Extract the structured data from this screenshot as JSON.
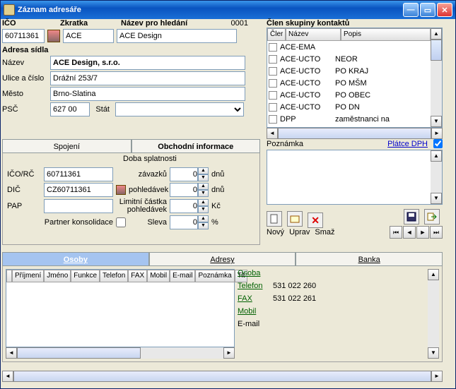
{
  "window": {
    "title": "Záznam adresáře"
  },
  "top": {
    "ico_label": "IČO",
    "zkratka_label": "Zkratka",
    "nazev_label": "Název pro hledání",
    "number": "0001",
    "ico": "60711361",
    "zkratka": "ACE",
    "nazev": "ACE Design"
  },
  "address": {
    "header": "Adresa sídla",
    "nazev_lbl": "Název",
    "nazev": "ACE Design, s.r.o.",
    "ulice_lbl": "Ulice a číslo",
    "ulice": "Drážní 253/7",
    "mesto_lbl": "Město",
    "mesto": "Brno-Slatina",
    "psc_lbl": "PSČ",
    "psc": "627 00",
    "stat_lbl": "Stát"
  },
  "tabs1": {
    "spojeni": "Spojení",
    "obchodni": "Obchodní informace"
  },
  "obchodni": {
    "doba": "Doba splatnosti",
    "icorc_lbl": "IČO/RČ",
    "icorc": "60711361",
    "dic_lbl": "DIČ",
    "dic": "CZ60711361",
    "pap_lbl": "PAP",
    "pap": "",
    "partner_lbl": "Partner konsolidace",
    "zavazku": "závazků",
    "zavazku_v": "0",
    "dnu": "dnů",
    "pohledavek": "pohledávek",
    "pohledavek_v": "0",
    "limit": "Limitní částka pohledávek",
    "limit_v": "0",
    "kc": "Kč",
    "sleva": "Sleva",
    "sleva_v": "0",
    "pct": "%"
  },
  "member": {
    "header": "Člen skupiny kontaktů",
    "cols": [
      "Čler",
      "Název",
      "Popis"
    ],
    "rows": [
      {
        "n": "ACE-EMA",
        "p": ""
      },
      {
        "n": "ACE-UCTO",
        "p": "NEOR"
      },
      {
        "n": "ACE-UCTO",
        "p": "PO KRAJ"
      },
      {
        "n": "ACE-UCTO",
        "p": "PO MŠM"
      },
      {
        "n": "ACE-UCTO",
        "p": "PO OBEC"
      },
      {
        "n": "ACE-UCTO",
        "p": "PO DN"
      },
      {
        "n": "DPP",
        "p": "zaměstnanci na"
      }
    ]
  },
  "right": {
    "poznamka_lbl": "Poznámka",
    "platce": "Plátce DPH",
    "novy": "Nový",
    "uprav": "Uprav",
    "smaz": "Smaž"
  },
  "tabs2": {
    "osoby": "Osoby",
    "adresy": "Adresy",
    "banka": "Banka"
  },
  "persons": {
    "cols": [
      "Příjmení",
      "Jméno",
      "Funkce",
      "Telefon",
      "FAX",
      "Mobil",
      "E-mail",
      "Poznámka",
      "Tit"
    ]
  },
  "details": {
    "osoba_lbl": "Osoba",
    "osoba": "",
    "telefon_lbl": "Telefon",
    "telefon": "531 022 260",
    "fax_lbl": "FAX",
    "fax": "531 022 261",
    "mobil_lbl": "Mobil",
    "mobil": "",
    "email_lbl": "E-mail",
    "email": ""
  }
}
